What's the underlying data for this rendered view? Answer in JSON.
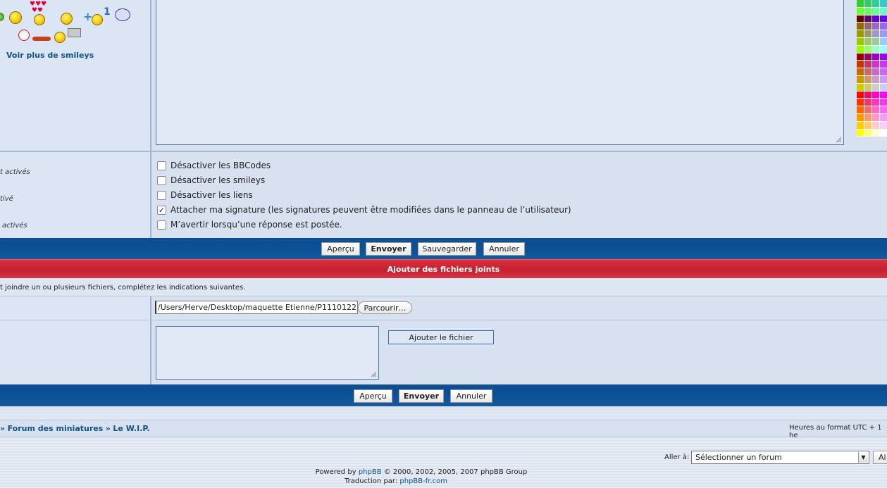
{
  "smileys": {
    "more_link": "Voir plus de smileys",
    "icons": [
      "smiley-green-icon",
      "smiley-laugh-icon",
      "smiley-love-icon",
      "smiley-wink-icon",
      "smiley-plus-one-icon",
      "smiley-bird-icon",
      "smiley-tongue-icon",
      "smiley-sleep-icon",
      "smiley-plain-icon",
      "smiley-sign-icon"
    ]
  },
  "options": {
    "left_labels": [
      "t activés",
      "tivé",
      "activés"
    ],
    "checkboxes": [
      {
        "label": "Désactiver les BBCodes",
        "checked": false
      },
      {
        "label": "Désactiver les smileys",
        "checked": false
      },
      {
        "label": "Désactiver les liens",
        "checked": false
      },
      {
        "label": "Attacher ma signature (les signatures peuvent être modifiées dans le panneau de l’utilisateur)",
        "checked": true
      },
      {
        "label": "M’avertir lorsqu’une réponse est postée.",
        "checked": false
      }
    ]
  },
  "toolbar1": {
    "preview": "Aperçu",
    "submit": "Envoyer",
    "save": "Sauvegarder",
    "cancel": "Annuler"
  },
  "attachments": {
    "header": "Ajouter des fichiers joints",
    "info": "t joindre un ou plusieurs fichiers, complétez les indications suivantes.",
    "file_path": "/Users/Herve/Desktop/maquette Etienne/P1110122.",
    "browse": "Parcourir…",
    "add_file": "Ajouter le fichier"
  },
  "toolbar2": {
    "preview": "Aperçu",
    "submit": "Envoyer",
    "cancel": "Annuler"
  },
  "breadcrumb": {
    "sep1": "»",
    "forum": "Forum des miniatures",
    "sep2": "»",
    "topic": "Le W.I.P."
  },
  "timezone": "Heures au format UTC + 1 he",
  "jump": {
    "label": "Aller à:",
    "selected": "Sélectionner un forum",
    "go": "Al"
  },
  "footer": {
    "powered_prefix": "Powered by",
    "phpbb": "phpBB",
    "powered_suffix": "© 2000, 2002, 2005, 2007 phpBB Group",
    "translation_prefix": "Traduction par:",
    "translation_link": "phpBB-fr.com"
  },
  "colors": {
    "bar_blue": "#0b4f96",
    "red_bar": "#c61f2f",
    "link": "#105289"
  },
  "palette_colors": [
    "#33cc33",
    "#33cc66",
    "#33cc99",
    "#33cccc",
    "#66ff33",
    "#66ff66",
    "#66ff99",
    "#66ffcc",
    "#660000",
    "#660066",
    "#6600cc",
    "#6600ff",
    "#996600",
    "#996666",
    "#9966cc",
    "#9966ff",
    "#999900",
    "#999966",
    "#9999cc",
    "#9999ff",
    "#99cc00",
    "#99cc66",
    "#99cc99",
    "#99ccff",
    "#99ff00",
    "#99ff66",
    "#99ffcc",
    "#99ffff",
    "#990000",
    "#990066",
    "#9900cc",
    "#9900ff",
    "#cc3300",
    "#cc3366",
    "#cc33cc",
    "#cc33ff",
    "#cc6600",
    "#cc6666",
    "#cc66cc",
    "#cc66ff",
    "#cc9900",
    "#cc9966",
    "#cc99cc",
    "#cc99ff",
    "#cccc00",
    "#cccc66",
    "#cccccc",
    "#ccccff",
    "#ff0000",
    "#ff0066",
    "#ff00cc",
    "#ff00ff",
    "#ff3300",
    "#ff3366",
    "#ff33cc",
    "#ff33ff",
    "#ff6600",
    "#ff6666",
    "#ff66cc",
    "#ff66ff",
    "#ff9900",
    "#ff9966",
    "#ff99cc",
    "#ff99ff",
    "#ffcc00",
    "#ffcc66",
    "#ffcccc",
    "#ffccff",
    "#ffff00",
    "#ffff66",
    "#ffffcc",
    "#ffffff"
  ]
}
